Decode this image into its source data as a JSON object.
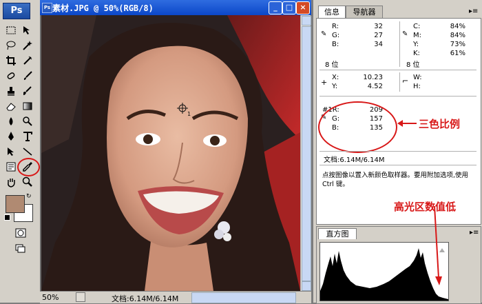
{
  "doc": {
    "title": "素材.JPG @ 50%(RGB/8)",
    "zoom": "50%",
    "status": "文档:6.14M/6.14M",
    "buttons": {
      "minimize": "_",
      "maximize": "□",
      "close": "×"
    }
  },
  "toolbox": {
    "logo": "Ps",
    "fg_color": "#b08a72",
    "bg_color": "#ffffff"
  },
  "panel": {
    "tabs": [
      "信息",
      "导航器"
    ],
    "info": {
      "rgb_labels": [
        "R:",
        "G:",
        "B:"
      ],
      "rgb_values": [
        "32",
        "27",
        "34"
      ],
      "cmyk_labels": [
        "C:",
        "M:",
        "Y:",
        "K:"
      ],
      "cmyk_values": [
        "84%",
        "84%",
        "73%",
        "61%"
      ],
      "bit_left": "8 位",
      "bit_right": "8 位",
      "x_label": "X:",
      "x_value": "10.23",
      "y_label": "Y:",
      "y_value": "4.52",
      "w_label": "W:",
      "h_label": "H:",
      "sample_labels": [
        "#1R:",
        "G:",
        "B:"
      ],
      "sample_values": [
        "209",
        "157",
        "135"
      ],
      "doc_size": "文档:6.14M/6.14M",
      "hint": "点按图像以置入新颜色取样器。要用附加选项,使用 Ctrl 键。"
    },
    "histogram_tab": "直方图"
  },
  "annotations": {
    "ratio": "三色比例",
    "highlight": "高光区数值低"
  },
  "colors": {
    "accent_red": "#d81818",
    "titlebar_blue": "#0b47c8"
  }
}
